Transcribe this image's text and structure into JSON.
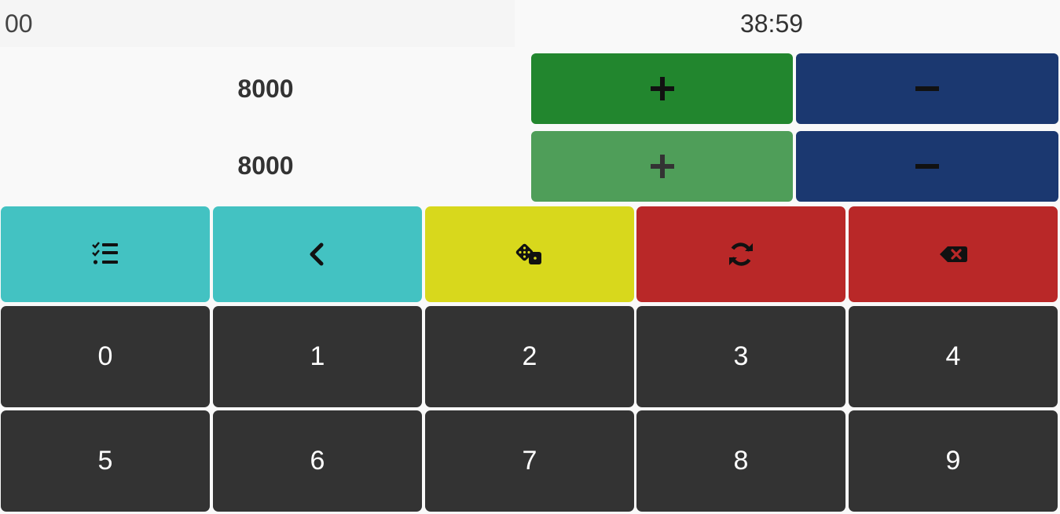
{
  "top_bar": {
    "input_value": "00",
    "timer": "38:59"
  },
  "scores": [
    {
      "value": "8000",
      "plus_icon": "plus-icon",
      "minus_icon": "minus-icon"
    },
    {
      "value": "8000",
      "plus_icon": "plus-icon",
      "minus_icon": "minus-icon"
    }
  ],
  "actions": [
    {
      "icon": "checklist-icon",
      "color": "#43c2c2"
    },
    {
      "icon": "chevron-left-icon",
      "color": "#43c2c2"
    },
    {
      "icon": "dice-icon",
      "color": "#d8d81c"
    },
    {
      "icon": "refresh-icon",
      "color": "#b92828"
    },
    {
      "icon": "backspace-icon",
      "color": "#b92828"
    }
  ],
  "keypad": [
    "0",
    "1",
    "2",
    "3",
    "4",
    "5",
    "6",
    "7",
    "8",
    "9"
  ],
  "colors": {
    "p1_plus": "#22862e",
    "p2_plus": "#4f9e59",
    "minus": "#1b3870",
    "keys": "#333333"
  }
}
